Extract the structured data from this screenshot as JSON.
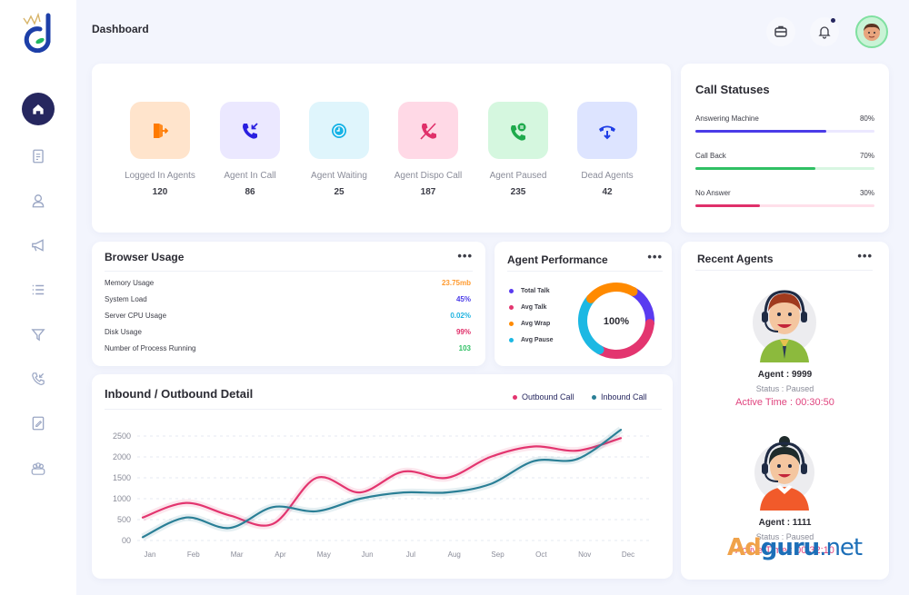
{
  "header": {
    "title": "Dashboard"
  },
  "topbar": {
    "icons": [
      "briefcase-icon",
      "bell-icon"
    ],
    "notification_dot": true
  },
  "sidebar": {
    "items": [
      {
        "name": "home",
        "icon": "home-icon",
        "active": true
      },
      {
        "name": "reports",
        "icon": "report-icon",
        "active": false
      },
      {
        "name": "users",
        "icon": "user-icon",
        "active": false
      },
      {
        "name": "campaigns",
        "icon": "megaphone-icon",
        "active": false
      },
      {
        "name": "lists",
        "icon": "list-icon",
        "active": false
      },
      {
        "name": "filters",
        "icon": "filter-icon",
        "active": false
      },
      {
        "name": "calls",
        "icon": "phone-incoming-icon",
        "active": false
      },
      {
        "name": "scripts",
        "icon": "edit-document-icon",
        "active": false
      },
      {
        "name": "groups",
        "icon": "group-icon",
        "active": false
      }
    ]
  },
  "stats": [
    {
      "label": "Logged In Agents",
      "value": "120",
      "icon": "door-exit-icon",
      "bg": "#ffe4cc",
      "fg": "#ff7a00"
    },
    {
      "label": "Agent In Call",
      "value": "86",
      "icon": "phone-incoming-icon",
      "bg": "#ebe8ff",
      "fg": "#2a1fe0"
    },
    {
      "label": "Agent Waiting",
      "value": "25",
      "icon": "clock-icon",
      "bg": "#dff5fc",
      "fg": "#16b3e6"
    },
    {
      "label": "Agent Dispo Call",
      "value": "187",
      "icon": "phone-off-icon",
      "bg": "#ffd9e6",
      "fg": "#e0306a"
    },
    {
      "label": "Agent Paused",
      "value": "235",
      "icon": "phone-paused-icon",
      "bg": "#d5f7df",
      "fg": "#1eaa4c"
    },
    {
      "label": "Dead Agents",
      "value": "42",
      "icon": "phone-hangup-icon",
      "bg": "#dde4ff",
      "fg": "#1f3ee6"
    }
  ],
  "call_statuses": {
    "title": "Call Statuses",
    "items": [
      {
        "label": "Answering Machine",
        "pct_label": "80%",
        "value": 0.73,
        "color": "#4a3be8",
        "track": "#ebe8ff"
      },
      {
        "label": "Call Back",
        "pct_label": "70%",
        "value": 0.67,
        "color": "#2fc064",
        "track": "#d8f6e2"
      },
      {
        "label": "No Answer",
        "pct_label": "30%",
        "value": 0.36,
        "color": "#e0306a",
        "track": "#ffe0ea"
      }
    ]
  },
  "browser_usage": {
    "title": "Browser Usage",
    "more": "•••",
    "rows": [
      {
        "label": "Memory Usage",
        "value": "23.75mb",
        "color": "#ff9a2e"
      },
      {
        "label": "System Load",
        "value": "45%",
        "color": "#4a3be8"
      },
      {
        "label": "Server CPU Usage",
        "value": "0.02%",
        "color": "#1fb3e0"
      },
      {
        "label": "Disk Usage",
        "value": "99%",
        "color": "#e0306a"
      },
      {
        "label": "Number of Process Running",
        "value": "103",
        "color": "#2fc064"
      }
    ]
  },
  "agent_performance": {
    "title": "Agent Performance",
    "more": "•••",
    "center_label": "100%",
    "legend": [
      {
        "label": "Total Talk",
        "color": "#5a3bf0",
        "share": 18
      },
      {
        "label": "Avg Talk",
        "color": "#e3356f",
        "share": 32
      },
      {
        "label": "Avg Wrap",
        "color": "#ff8a00",
        "share": 22
      },
      {
        "label": "Avg Pause",
        "color": "#1cb8e3",
        "share": 28
      }
    ]
  },
  "recent_agents": {
    "title": "Recent Agents",
    "more": "•••",
    "agents": [
      {
        "name": "Agent : 9999",
        "status": "Status : Paused",
        "active_time": "Active Time : 00:30:50",
        "avatar": "male-agent-avatar"
      },
      {
        "name": "Agent : 1111",
        "status": "Status : Paused",
        "active_time": "Active Time : 00:32:10",
        "avatar": "female-agent-avatar"
      }
    ]
  },
  "chart_data": {
    "type": "line",
    "title": "Inbound / Outbound Detail",
    "xlabel": "",
    "ylabel": "",
    "categories": [
      "Jan",
      "Feb",
      "Mar",
      "Apr",
      "May",
      "Jun",
      "Jul",
      "Aug",
      "Sep",
      "Oct",
      "Nov",
      "Dec"
    ],
    "y_ticks": [
      "00",
      "500",
      "1000",
      "1500",
      "2000",
      "2500"
    ],
    "ylim": [
      0,
      2500
    ],
    "grid": true,
    "legend_position": "top-right",
    "series": [
      {
        "name": "Outbound Call",
        "color": "#e3356f",
        "values": [
          550,
          900,
          600,
          400,
          1500,
          1150,
          1650,
          1500,
          2000,
          2250,
          2150,
          2450
        ]
      },
      {
        "name": "Inbound Call",
        "color": "#2a7f96",
        "values": [
          80,
          550,
          300,
          800,
          700,
          1000,
          1150,
          1150,
          1350,
          1900,
          1950,
          2650
        ]
      }
    ]
  },
  "watermark": {
    "part1": "Ad",
    "part2": "guru",
    "part3": ".net"
  }
}
